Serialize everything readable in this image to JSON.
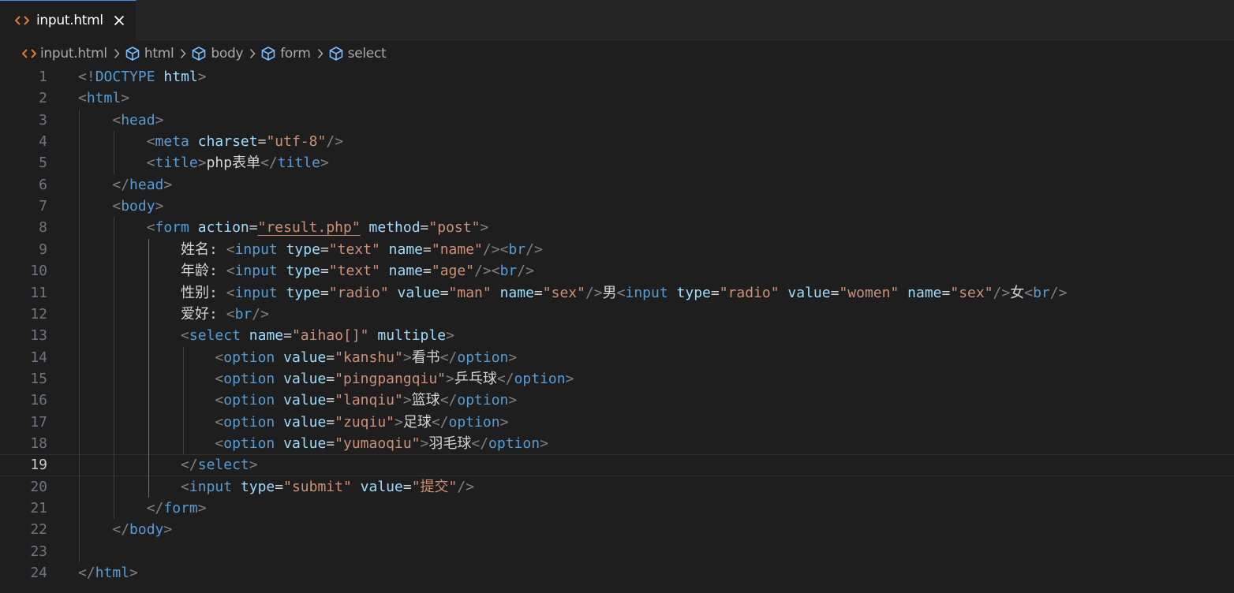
{
  "colors": {
    "tag": "#569cd6",
    "attribute": "#9cdcfe",
    "string": "#ce9178",
    "punctuation": "#808080",
    "text": "#d4d4d4",
    "line_number": "#6e7681",
    "active_tab_accent": "#3794ff",
    "html_file_icon": "#e37933",
    "symbol_icon": "#75beff"
  },
  "tab": {
    "label": "input.html",
    "icon": "html-file-icon",
    "close_icon": "close-icon"
  },
  "breadcrumb": [
    {
      "label": "input.html",
      "icon": "html-file-icon"
    },
    {
      "label": "html",
      "icon": "symbol-element-icon"
    },
    {
      "label": "body",
      "icon": "symbol-element-icon"
    },
    {
      "label": "form",
      "icon": "symbol-element-icon"
    },
    {
      "label": "select",
      "icon": "symbol-element-icon"
    }
  ],
  "editor": {
    "current_line": 19,
    "lines": [
      {
        "n": "1",
        "tokens": [
          [
            "punc",
            "<!"
          ],
          [
            "doctype-kw",
            "DOCTYPE"
          ],
          [
            "text",
            " "
          ],
          [
            "doctype-name",
            "html"
          ],
          [
            "punc",
            ">"
          ]
        ]
      },
      {
        "n": "2",
        "tokens": [
          [
            "punc",
            "<"
          ],
          [
            "tag",
            "html"
          ],
          [
            "punc",
            ">"
          ]
        ]
      },
      {
        "n": "3",
        "tokens": [
          [
            "text",
            "    "
          ],
          [
            "punc",
            "<"
          ],
          [
            "tag",
            "head"
          ],
          [
            "punc",
            ">"
          ]
        ]
      },
      {
        "n": "4",
        "tokens": [
          [
            "text",
            "        "
          ],
          [
            "punc",
            "<"
          ],
          [
            "tag",
            "meta"
          ],
          [
            "text",
            " "
          ],
          [
            "attr",
            "charset"
          ],
          [
            "text",
            "="
          ],
          [
            "str",
            "\"utf-8\""
          ],
          [
            "punc",
            "/>"
          ]
        ]
      },
      {
        "n": "5",
        "tokens": [
          [
            "text",
            "        "
          ],
          [
            "punc",
            "<"
          ],
          [
            "tag",
            "title"
          ],
          [
            "punc",
            ">"
          ],
          [
            "text",
            "php表单"
          ],
          [
            "punc",
            "</"
          ],
          [
            "tag",
            "title"
          ],
          [
            "punc",
            ">"
          ]
        ]
      },
      {
        "n": "6",
        "tokens": [
          [
            "text",
            "    "
          ],
          [
            "punc",
            "</"
          ],
          [
            "tag",
            "head"
          ],
          [
            "punc",
            ">"
          ]
        ]
      },
      {
        "n": "7",
        "tokens": [
          [
            "text",
            "    "
          ],
          [
            "punc",
            "<"
          ],
          [
            "tag",
            "body"
          ],
          [
            "punc",
            ">"
          ]
        ]
      },
      {
        "n": "8",
        "tokens": [
          [
            "text",
            "        "
          ],
          [
            "punc",
            "<"
          ],
          [
            "tag",
            "form"
          ],
          [
            "text",
            " "
          ],
          [
            "attr",
            "action"
          ],
          [
            "text",
            "="
          ],
          [
            "str-link",
            "\"result.php\""
          ],
          [
            "text",
            " "
          ],
          [
            "attr",
            "method"
          ],
          [
            "text",
            "="
          ],
          [
            "str",
            "\"post\""
          ],
          [
            "punc",
            ">"
          ]
        ]
      },
      {
        "n": "9",
        "tokens": [
          [
            "text",
            "            姓名: "
          ],
          [
            "punc",
            "<"
          ],
          [
            "tag",
            "input"
          ],
          [
            "text",
            " "
          ],
          [
            "attr",
            "type"
          ],
          [
            "text",
            "="
          ],
          [
            "str",
            "\"text\""
          ],
          [
            "text",
            " "
          ],
          [
            "attr",
            "name"
          ],
          [
            "text",
            "="
          ],
          [
            "str",
            "\"name\""
          ],
          [
            "punc",
            "/><"
          ],
          [
            "tag",
            "br"
          ],
          [
            "punc",
            "/>"
          ]
        ]
      },
      {
        "n": "10",
        "tokens": [
          [
            "text",
            "            年龄: "
          ],
          [
            "punc",
            "<"
          ],
          [
            "tag",
            "input"
          ],
          [
            "text",
            " "
          ],
          [
            "attr",
            "type"
          ],
          [
            "text",
            "="
          ],
          [
            "str",
            "\"text\""
          ],
          [
            "text",
            " "
          ],
          [
            "attr",
            "name"
          ],
          [
            "text",
            "="
          ],
          [
            "str",
            "\"age\""
          ],
          [
            "punc",
            "/><"
          ],
          [
            "tag",
            "br"
          ],
          [
            "punc",
            "/>"
          ]
        ]
      },
      {
        "n": "11",
        "tokens": [
          [
            "text",
            "            性别: "
          ],
          [
            "punc",
            "<"
          ],
          [
            "tag",
            "input"
          ],
          [
            "text",
            " "
          ],
          [
            "attr",
            "type"
          ],
          [
            "text",
            "="
          ],
          [
            "str",
            "\"radio\""
          ],
          [
            "text",
            " "
          ],
          [
            "attr",
            "value"
          ],
          [
            "text",
            "="
          ],
          [
            "str",
            "\"man\""
          ],
          [
            "text",
            " "
          ],
          [
            "attr",
            "name"
          ],
          [
            "text",
            "="
          ],
          [
            "str",
            "\"sex\""
          ],
          [
            "punc",
            "/>"
          ],
          [
            "text",
            "男"
          ],
          [
            "punc",
            "<"
          ],
          [
            "tag",
            "input"
          ],
          [
            "text",
            " "
          ],
          [
            "attr",
            "type"
          ],
          [
            "text",
            "="
          ],
          [
            "str",
            "\"radio\""
          ],
          [
            "text",
            " "
          ],
          [
            "attr",
            "value"
          ],
          [
            "text",
            "="
          ],
          [
            "str",
            "\"women\""
          ],
          [
            "text",
            " "
          ],
          [
            "attr",
            "name"
          ],
          [
            "text",
            "="
          ],
          [
            "str",
            "\"sex\""
          ],
          [
            "punc",
            "/>"
          ],
          [
            "text",
            "女"
          ],
          [
            "punc",
            "<"
          ],
          [
            "tag",
            "br"
          ],
          [
            "punc",
            "/>"
          ]
        ]
      },
      {
        "n": "12",
        "tokens": [
          [
            "text",
            "            爱好: "
          ],
          [
            "punc",
            "<"
          ],
          [
            "tag",
            "br"
          ],
          [
            "punc",
            "/>"
          ]
        ]
      },
      {
        "n": "13",
        "tokens": [
          [
            "text",
            "            "
          ],
          [
            "punc",
            "<"
          ],
          [
            "tag",
            "select"
          ],
          [
            "text",
            " "
          ],
          [
            "attr",
            "name"
          ],
          [
            "text",
            "="
          ],
          [
            "str",
            "\"aihao[]\""
          ],
          [
            "text",
            " "
          ],
          [
            "attr",
            "multiple"
          ],
          [
            "punc",
            ">"
          ]
        ]
      },
      {
        "n": "14",
        "tokens": [
          [
            "text",
            "                "
          ],
          [
            "punc",
            "<"
          ],
          [
            "tag",
            "option"
          ],
          [
            "text",
            " "
          ],
          [
            "attr",
            "value"
          ],
          [
            "text",
            "="
          ],
          [
            "str",
            "\"kanshu\""
          ],
          [
            "punc",
            ">"
          ],
          [
            "text",
            "看书"
          ],
          [
            "punc",
            "</"
          ],
          [
            "tag",
            "option"
          ],
          [
            "punc",
            ">"
          ]
        ]
      },
      {
        "n": "15",
        "tokens": [
          [
            "text",
            "                "
          ],
          [
            "punc",
            "<"
          ],
          [
            "tag",
            "option"
          ],
          [
            "text",
            " "
          ],
          [
            "attr",
            "value"
          ],
          [
            "text",
            "="
          ],
          [
            "str",
            "\"pingpangqiu\""
          ],
          [
            "punc",
            ">"
          ],
          [
            "text",
            "乒乓球"
          ],
          [
            "punc",
            "</"
          ],
          [
            "tag",
            "option"
          ],
          [
            "punc",
            ">"
          ]
        ]
      },
      {
        "n": "16",
        "tokens": [
          [
            "text",
            "                "
          ],
          [
            "punc",
            "<"
          ],
          [
            "tag",
            "option"
          ],
          [
            "text",
            " "
          ],
          [
            "attr",
            "value"
          ],
          [
            "text",
            "="
          ],
          [
            "str",
            "\"lanqiu\""
          ],
          [
            "punc",
            ">"
          ],
          [
            "text",
            "篮球"
          ],
          [
            "punc",
            "</"
          ],
          [
            "tag",
            "option"
          ],
          [
            "punc",
            ">"
          ]
        ]
      },
      {
        "n": "17",
        "tokens": [
          [
            "text",
            "                "
          ],
          [
            "punc",
            "<"
          ],
          [
            "tag",
            "option"
          ],
          [
            "text",
            " "
          ],
          [
            "attr",
            "value"
          ],
          [
            "text",
            "="
          ],
          [
            "str",
            "\"zuqiu\""
          ],
          [
            "punc",
            ">"
          ],
          [
            "text",
            "足球"
          ],
          [
            "punc",
            "</"
          ],
          [
            "tag",
            "option"
          ],
          [
            "punc",
            ">"
          ]
        ]
      },
      {
        "n": "18",
        "tokens": [
          [
            "text",
            "                "
          ],
          [
            "punc",
            "<"
          ],
          [
            "tag",
            "option"
          ],
          [
            "text",
            " "
          ],
          [
            "attr",
            "value"
          ],
          [
            "text",
            "="
          ],
          [
            "str",
            "\"yumaoqiu\""
          ],
          [
            "punc",
            ">"
          ],
          [
            "text",
            "羽毛球"
          ],
          [
            "punc",
            "</"
          ],
          [
            "tag",
            "option"
          ],
          [
            "punc",
            ">"
          ]
        ]
      },
      {
        "n": "19",
        "tokens": [
          [
            "text",
            "            "
          ],
          [
            "punc",
            "</"
          ],
          [
            "tag",
            "select"
          ],
          [
            "punc",
            ">"
          ]
        ]
      },
      {
        "n": "20",
        "tokens": [
          [
            "text",
            "            "
          ],
          [
            "punc",
            "<"
          ],
          [
            "tag",
            "input"
          ],
          [
            "text",
            " "
          ],
          [
            "attr",
            "type"
          ],
          [
            "text",
            "="
          ],
          [
            "str",
            "\"submit\""
          ],
          [
            "text",
            " "
          ],
          [
            "attr",
            "value"
          ],
          [
            "text",
            "="
          ],
          [
            "str",
            "\"提交\""
          ],
          [
            "punc",
            "/>"
          ]
        ]
      },
      {
        "n": "21",
        "tokens": [
          [
            "text",
            "        "
          ],
          [
            "punc",
            "</"
          ],
          [
            "tag",
            "form"
          ],
          [
            "punc",
            ">"
          ]
        ]
      },
      {
        "n": "22",
        "tokens": [
          [
            "text",
            "    "
          ],
          [
            "punc",
            "</"
          ],
          [
            "tag",
            "body"
          ],
          [
            "punc",
            ">"
          ]
        ]
      },
      {
        "n": "23",
        "tokens": []
      },
      {
        "n": "24",
        "tokens": [
          [
            "punc",
            "</"
          ],
          [
            "tag",
            "html"
          ],
          [
            "punc",
            ">"
          ]
        ]
      }
    ]
  }
}
